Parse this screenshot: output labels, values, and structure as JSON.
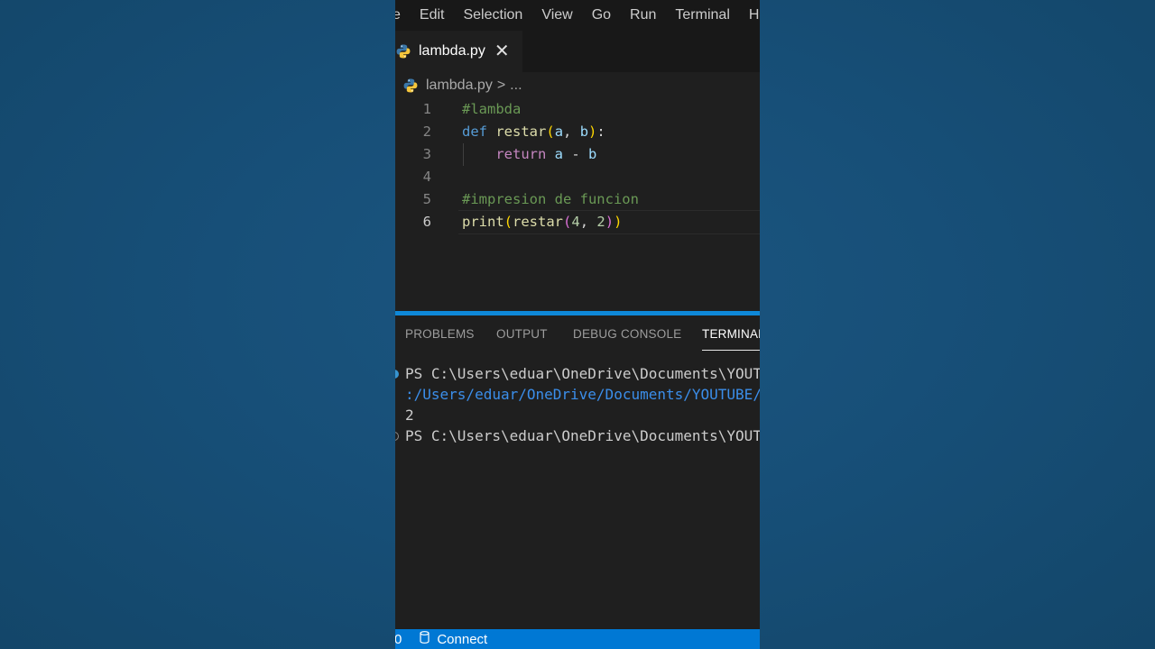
{
  "menu": [
    "e",
    "Edit",
    "Selection",
    "View",
    "Go",
    "Run",
    "Terminal",
    "H"
  ],
  "tab": {
    "label": "lambda.py",
    "close": "✕"
  },
  "breadcrumb": {
    "file": "lambda.py",
    "separator": ">",
    "more": "..."
  },
  "editor": {
    "current_line": 6,
    "lines": [
      {
        "number": "1",
        "tokens": [
          {
            "text": "#lambda",
            "type": "comment"
          }
        ]
      },
      {
        "number": "2",
        "tokens": [
          {
            "text": "def",
            "type": "keyword"
          },
          {
            "text": " ",
            "type": "plain"
          },
          {
            "text": "restar",
            "type": "func"
          },
          {
            "text": "(",
            "type": "paren1"
          },
          {
            "text": "a",
            "type": "param"
          },
          {
            "text": ", ",
            "type": "plain"
          },
          {
            "text": "b",
            "type": "param"
          },
          {
            "text": ")",
            "type": "paren1"
          },
          {
            "text": ":",
            "type": "plain"
          }
        ]
      },
      {
        "number": "3",
        "indent": true,
        "tokens": [
          {
            "text": "    ",
            "type": "plain"
          },
          {
            "text": "return",
            "type": "control"
          },
          {
            "text": " ",
            "type": "plain"
          },
          {
            "text": "a",
            "type": "param"
          },
          {
            "text": " - ",
            "type": "plain"
          },
          {
            "text": "b",
            "type": "param"
          }
        ]
      },
      {
        "number": "4",
        "tokens": []
      },
      {
        "number": "5",
        "tokens": [
          {
            "text": "#impresion de funcion",
            "type": "comment"
          }
        ]
      },
      {
        "number": "6",
        "tokens": [
          {
            "text": "print",
            "type": "func"
          },
          {
            "text": "(",
            "type": "paren1"
          },
          {
            "text": "restar",
            "type": "func"
          },
          {
            "text": "(",
            "type": "paren2"
          },
          {
            "text": "4",
            "type": "number"
          },
          {
            "text": ", ",
            "type": "plain"
          },
          {
            "text": "2",
            "type": "number"
          },
          {
            "text": ")",
            "type": "paren2"
          },
          {
            "text": ")",
            "type": "paren1"
          }
        ]
      }
    ]
  },
  "panel": {
    "tabs": [
      {
        "label": "PROBLEMS",
        "active": false
      },
      {
        "label": "OUTPUT",
        "active": false
      },
      {
        "label": "DEBUG CONSOLE",
        "active": false
      },
      {
        "label": "TERMINAL",
        "active": true
      }
    ]
  },
  "terminal": {
    "lines": [
      {
        "text": "PS C:\\Users\\eduar\\OneDrive\\Documents\\YOUTUBE",
        "style": "prompt",
        "dot": "filled"
      },
      {
        "text": ":/Users/eduar/OneDrive/Documents/YOUTUBE/s",
        "style": "path",
        "dot": ""
      },
      {
        "text": "2",
        "style": "output",
        "dot": ""
      },
      {
        "text": "PS C:\\Users\\eduar\\OneDrive\\Documents\\YOUTUBE",
        "style": "prompt",
        "dot": "hollow"
      }
    ]
  },
  "statusbar": {
    "left": "0",
    "connect": "Connect"
  },
  "colors": {
    "accent": "#0078d4",
    "panel_border": "#0e88d8",
    "background": "#1b5680",
    "editor_bg": "#1f1f1f"
  }
}
